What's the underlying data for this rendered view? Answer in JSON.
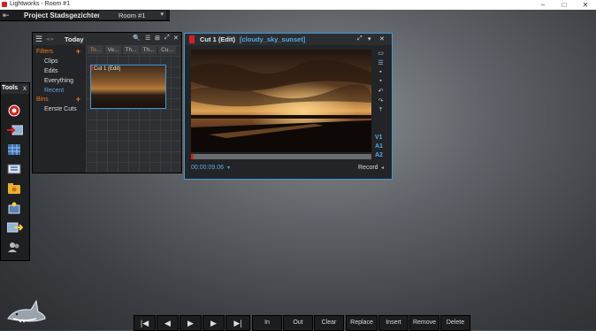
{
  "window": {
    "title": "Lightworks - Room #1",
    "controls": [
      "–",
      "□",
      "✕"
    ]
  },
  "project": {
    "exit_icon": "exit-icon",
    "name": "Project Stadsgezichten",
    "room": "Room #1",
    "room_arrow": "▾"
  },
  "tools": {
    "title": "Tools",
    "close": "x",
    "icons": [
      "record-icon",
      "import-icon",
      "sequence-icon",
      "storyboard-icon",
      "folder-icon",
      "effects-icon",
      "export-icon",
      "users-icon"
    ]
  },
  "bin": {
    "title": "Today",
    "menu_icon": "☰",
    "nav": "◂ ▸",
    "filters_label": "Filters",
    "filter_items": [
      "Clips",
      "Edits",
      "Everything",
      "Recent"
    ],
    "bins_label": "Bins",
    "bin_items": [
      "Eerste Cuts"
    ],
    "columns": [
      "To...",
      "Ve...",
      "Th...",
      "Th...",
      "Cu..."
    ],
    "thumb_label": "Cut 1 (Edit)",
    "header_icons": [
      "🔍",
      "☰",
      "⊞",
      "⤢",
      "✕"
    ]
  },
  "viewer": {
    "title": "Cut 1 (Edit)",
    "clip": "[cloudy_sky_sunset]",
    "header_icons": [
      "⤢",
      "▾",
      "✕"
    ],
    "timecode": "00:00:09.06",
    "timecode_arrow": "▾",
    "record_label": "Record",
    "tracks": [
      "V1",
      "A1",
      "A2"
    ]
  },
  "transport": {
    "buttons": [
      "|◀",
      "◀",
      "▶",
      "▶",
      "▶|"
    ],
    "actions": [
      "In",
      "Out",
      "Clear",
      "Replace",
      "Insert",
      "Remove",
      "Delete"
    ]
  },
  "colors": {
    "accent_orange": "#f07a1d",
    "accent_blue": "#3d9ad6",
    "record_red": "#d62020"
  }
}
